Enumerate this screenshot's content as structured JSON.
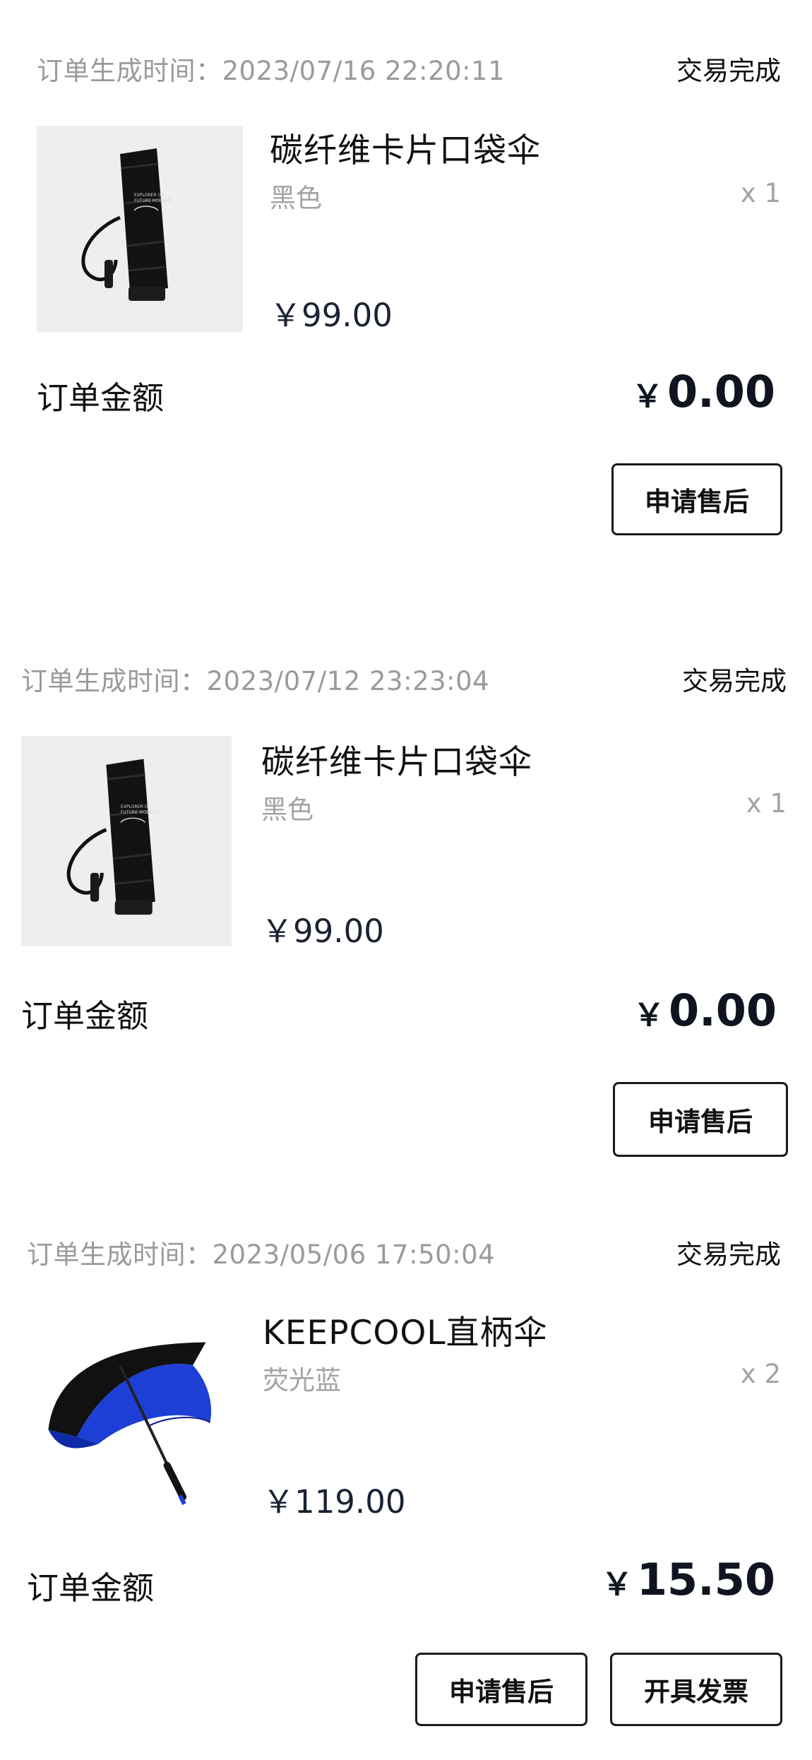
{
  "orders": [
    {
      "time_label": "订单生成时间：",
      "time_value": "2023/07/16 22:20:11",
      "status": "交易完成",
      "product": {
        "name": "碳纤维卡片口袋伞",
        "variant": "黑色",
        "qty": "x 1",
        "price": "￥99.00",
        "image_icon": "black-pocket-umbrella-image"
      },
      "amount_label": "订单金额",
      "amount_currency": "￥",
      "amount_value": "0.00",
      "buttons": [
        "申请售后"
      ]
    },
    {
      "time_label": "订单生成时间：",
      "time_value": "2023/07/12 23:23:04",
      "status": "交易完成",
      "product": {
        "name": "碳纤维卡片口袋伞",
        "variant": "黑色",
        "qty": "x 1",
        "price": "￥99.00",
        "image_icon": "black-pocket-umbrella-image"
      },
      "amount_label": "订单金额",
      "amount_currency": "￥",
      "amount_value": "0.00",
      "buttons": [
        "申请售后"
      ]
    },
    {
      "time_label": "订单生成时间：",
      "time_value": "2023/05/06 17:50:04",
      "status": "交易完成",
      "product": {
        "name": "KEEPCOOL直柄伞",
        "variant": "荧光蓝",
        "qty": "x 2",
        "price": "￥119.00",
        "image_icon": "blue-straight-umbrella-image"
      },
      "amount_label": "订单金额",
      "amount_currency": "￥",
      "amount_value": "15.50",
      "buttons": [
        "申请售后",
        "开具发票"
      ]
    }
  ],
  "colors": {
    "muted_text": "#9a9a9a",
    "primary_text": "#111111",
    "price_text": "#1a2233",
    "umbrella_blue": "#1e3fd6"
  }
}
